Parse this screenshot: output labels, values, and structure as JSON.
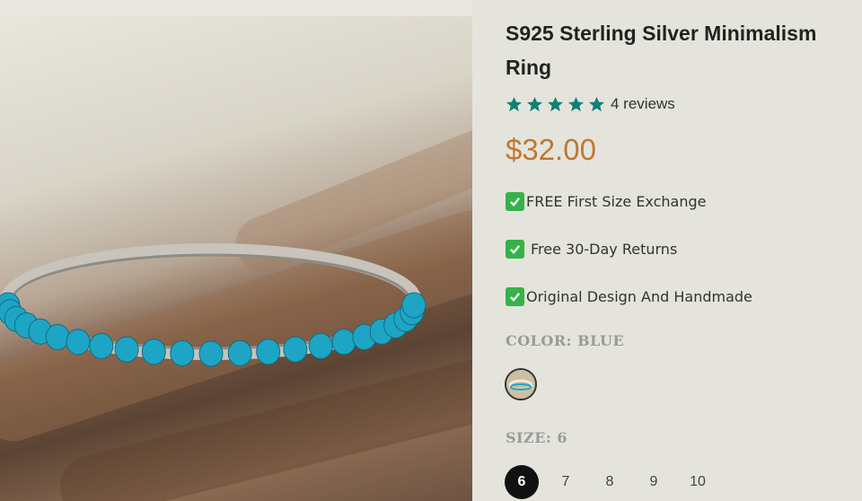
{
  "product": {
    "title": "S925 Sterling Silver Minimalism Ring",
    "rating": {
      "stars": 5,
      "reviews_label": "4 reviews"
    },
    "price": "$32.00",
    "features": [
      "FREE First Size Exchange",
      "Free 30-Day Returns",
      "Original Design And Handmade"
    ],
    "color": {
      "label": "COLOR: BLUE"
    },
    "size": {
      "label": "SIZE: 6",
      "options": [
        "6",
        "7",
        "8",
        "9",
        "10"
      ],
      "selected": "6"
    }
  },
  "colors": {
    "price": "#c0782e",
    "star": "#137f74",
    "check": "#36b24a",
    "turquoise": "#1ea5c5"
  },
  "icons": [
    "product-photo-ring",
    "star-icon",
    "check-icon",
    "color-swatch"
  ]
}
